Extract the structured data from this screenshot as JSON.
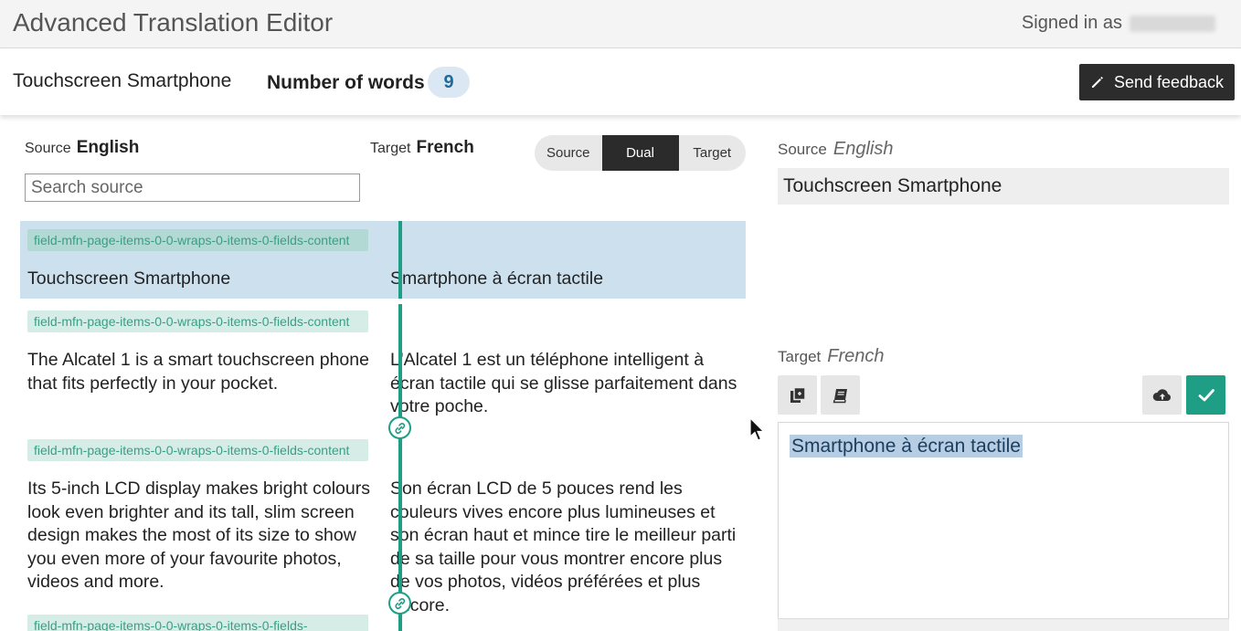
{
  "app": {
    "title": "Advanced Translation Editor",
    "signed_in_label": "Signed in as"
  },
  "document": {
    "title": "Touchscreen Smartphone",
    "words_label": "Number of words",
    "words_count": "9"
  },
  "feedback": {
    "label": "Send feedback",
    "icon": "pencil-icon"
  },
  "list": {
    "source_label": "Source",
    "source_lang": "English",
    "target_label": "Target",
    "target_lang": "French",
    "search_placeholder": "Search source",
    "view_modes": [
      "Source",
      "Dual",
      "Target"
    ],
    "active_view": "Dual"
  },
  "segments": [
    {
      "key": "field-mfn-page-items-0-0-wraps-0-items-0-fields-content",
      "source": "Touchscreen Smartphone",
      "target": "Smartphone à écran tactile",
      "selected": true
    },
    {
      "key": "field-mfn-page-items-0-0-wraps-0-items-0-fields-content",
      "source": "The Alcatel 1 is a smart touchscreen phone that fits perfectly in your pocket.",
      "target": "L'Alcatel 1 est un téléphone intelligent à écran tactile qui se glisse parfaitement dans votre poche.",
      "selected": false
    },
    {
      "key": "field-mfn-page-items-0-0-wraps-0-items-0-fields-content",
      "source": "Its 5-inch LCD display makes bright colours look even brighter and its tall, slim screen design makes the most of its size to show you even more of your favourite photos, videos and more.",
      "target": "Son écran LCD de 5 pouces rend les couleurs vives encore plus lumineuses et son écran haut et mince tire le meilleur parti de sa taille pour vous montrer encore plus de vos photos, vidéos préférées et plus encore.",
      "selected": false
    },
    {
      "key": "field-mfn-page-items-0-0-wraps-0-items-0-fields-",
      "source": "",
      "target": "",
      "selected": false
    }
  ],
  "editor": {
    "source_label": "Source",
    "source_lang": "English",
    "source_text": "Touchscreen Smartphone",
    "target_label": "Target",
    "target_lang": "French",
    "target_text": "Smartphone à écran tactile",
    "tools": [
      "copy-source-icon",
      "glossary-book-icon",
      "cloud-upload-icon",
      "checkmark-icon"
    ]
  },
  "colors": {
    "accent": "#1f9e86",
    "selected_row": "#cde0ee",
    "dark_button": "#2c2c2c",
    "word_badge": "#dbe8f3"
  }
}
